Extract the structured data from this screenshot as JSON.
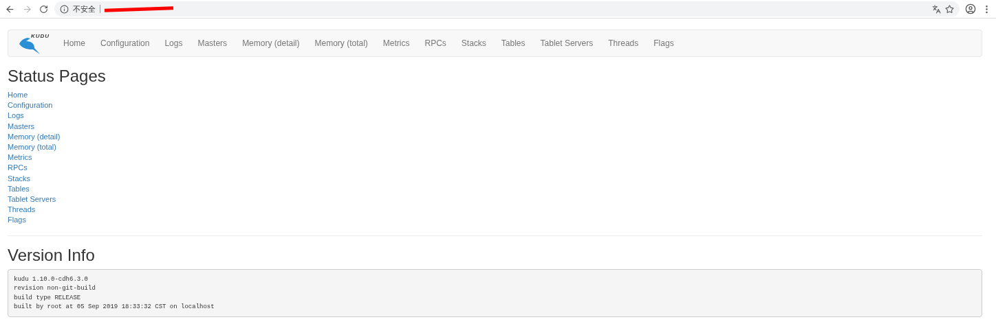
{
  "browser": {
    "security_label": "不安全"
  },
  "navbar": {
    "logo_text": "KUDU",
    "items": [
      "Home",
      "Configuration",
      "Logs",
      "Masters",
      "Memory (detail)",
      "Memory (total)",
      "Metrics",
      "RPCs",
      "Stacks",
      "Tables",
      "Tablet Servers",
      "Threads",
      "Flags"
    ]
  },
  "status_pages": {
    "title": "Status Pages",
    "links": [
      "Home",
      "Configuration",
      "Logs",
      "Masters",
      "Memory (detail)",
      "Memory (total)",
      "Metrics",
      "RPCs",
      "Stacks",
      "Tables",
      "Tablet Servers",
      "Threads",
      "Flags"
    ]
  },
  "version_info": {
    "title": "Version Info",
    "lines": [
      "kudu 1.10.0-cdh6.3.0",
      "revision non-git-build",
      "build type RELEASE",
      "built by root at 05 Sep 2019 18:33:32 CST on localhost"
    ]
  }
}
